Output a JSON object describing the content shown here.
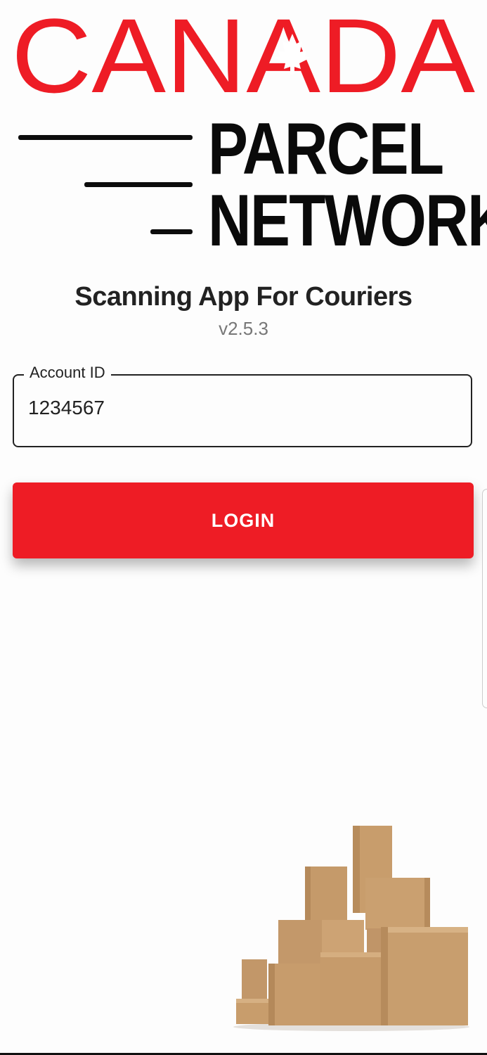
{
  "logo": {
    "word_canada": "CANADA",
    "word_parcel": "PARCEL",
    "word_network": "NETWORK"
  },
  "app": {
    "title": "Scanning App For Couriers",
    "version": "v2.5.3"
  },
  "login_form": {
    "account_label": "Account ID",
    "account_value": "1234567",
    "login_label": "LOGIN"
  },
  "colors": {
    "brand_red": "#ee1c25",
    "logo_black": "#0a0a0a",
    "box_cardboard": "#c59a6a"
  },
  "icons": {
    "maple_leaf": "maple-leaf-icon",
    "boxes": "cardboard-boxes-illustration"
  }
}
